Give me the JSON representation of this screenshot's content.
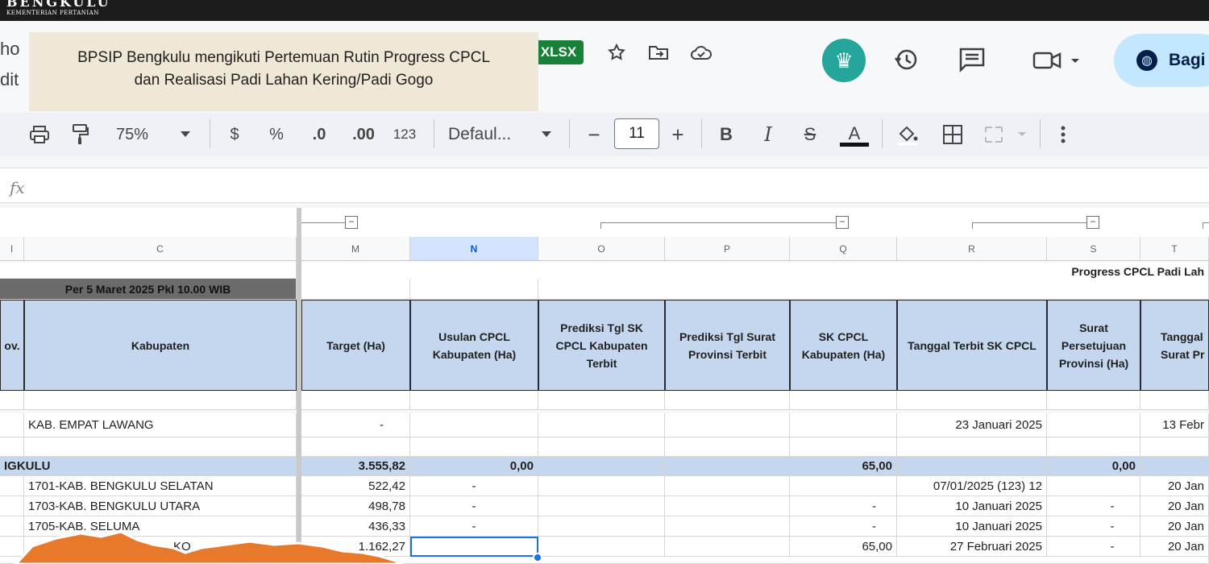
{
  "logo": {
    "name": "BENGKULU",
    "sub": "KEMENTERIAN PERTANIAN"
  },
  "doc": {
    "title_cut": "ho",
    "menu_cut": "dit",
    "format_badge": "XLSX"
  },
  "caption": {
    "line1": "BPSIP Bengkulu mengikuti Pertemuan Rutin Progress CPCL",
    "line2": "dan Realisasi Padi Lahan Kering/Padi Gogo"
  },
  "share": {
    "label": "Bagi"
  },
  "toolbar": {
    "zoom": "75%",
    "currency": "$",
    "percent": "%",
    "dec_decrease": ".0",
    "dec_increase": ".00",
    "number_format": "123",
    "font": "Defaul...",
    "font_size": "11",
    "minus": "−",
    "plus": "+",
    "bold": "B",
    "italic": "I",
    "strike": "S",
    "text_color": "A"
  },
  "formula": {
    "fx": "fx"
  },
  "columns": [
    "I",
    "C",
    "M",
    "N",
    "O",
    "P",
    "Q",
    "R",
    "S",
    "T"
  ],
  "sheet": {
    "title_right": "Progress CPCL Padi Lah",
    "date_banner": "Per 5 Maret 2025 Pkl 10.00 WIB",
    "headers": {
      "prov": "ov.",
      "kabupaten": "Kabupaten",
      "target": "Target (Ha)",
      "usulan": "Usulan CPCL Kabupaten (Ha)",
      "prediksi_sk": "Prediksi Tgl SK CPCL Kabupaten Terbit",
      "prediksi_surat": "Prediksi Tgl Surat Provinsi Terbit",
      "sk_cpcl": "SK CPCL Kabupaten (Ha)",
      "tanggal_sk": "Tanggal Terbit SK CPCL",
      "surat": "Surat Persetujuan Provinsi (Ha)",
      "tanggal_surat": "Tanggal Surat Pr"
    },
    "row_empat": {
      "kab": "KAB. EMPAT LAWANG",
      "target": "-",
      "tanggal_sk": "23 Januari 2025",
      "tanggal_surat": "13 Febr"
    },
    "row_prov": {
      "name": "IGKULU",
      "target": "3.555,82",
      "usulan": "0,00",
      "sk": "65,00",
      "surat": "0,00"
    },
    "rows": [
      {
        "kab": "1701-KAB. BENGKULU SELATAN",
        "target": "522,42",
        "usulan": "-",
        "sk": "",
        "tanggal_sk": "07/01/2025 (123) 12",
        "surat": "",
        "tanggal_surat": "20 Jan"
      },
      {
        "kab": "1703-KAB. BENGKULU UTARA",
        "target": "498,78",
        "usulan": "-",
        "sk": "-",
        "tanggal_sk": "10 Januari 2025",
        "surat": "-",
        "tanggal_surat": "20 Jan"
      },
      {
        "kab": "1705-KAB. SELUMA",
        "target": "436,33",
        "usulan": "-",
        "sk": "-",
        "tanggal_sk": "10 Januari 2025",
        "surat": "-",
        "tanggal_surat": "20 Jan"
      },
      {
        "kab": "KO",
        "target": "1.162,27",
        "usulan": "",
        "sk": "65,00",
        "tanggal_sk": "27 Februari 2025",
        "surat": "-",
        "tanggal_surat": "20 Jan"
      }
    ]
  },
  "colors": {
    "header_fill": "#c5d7ee",
    "xlsx_badge": "#188038",
    "share_fill": "#c2e7ff",
    "caption_fill": "#efe8d6"
  }
}
